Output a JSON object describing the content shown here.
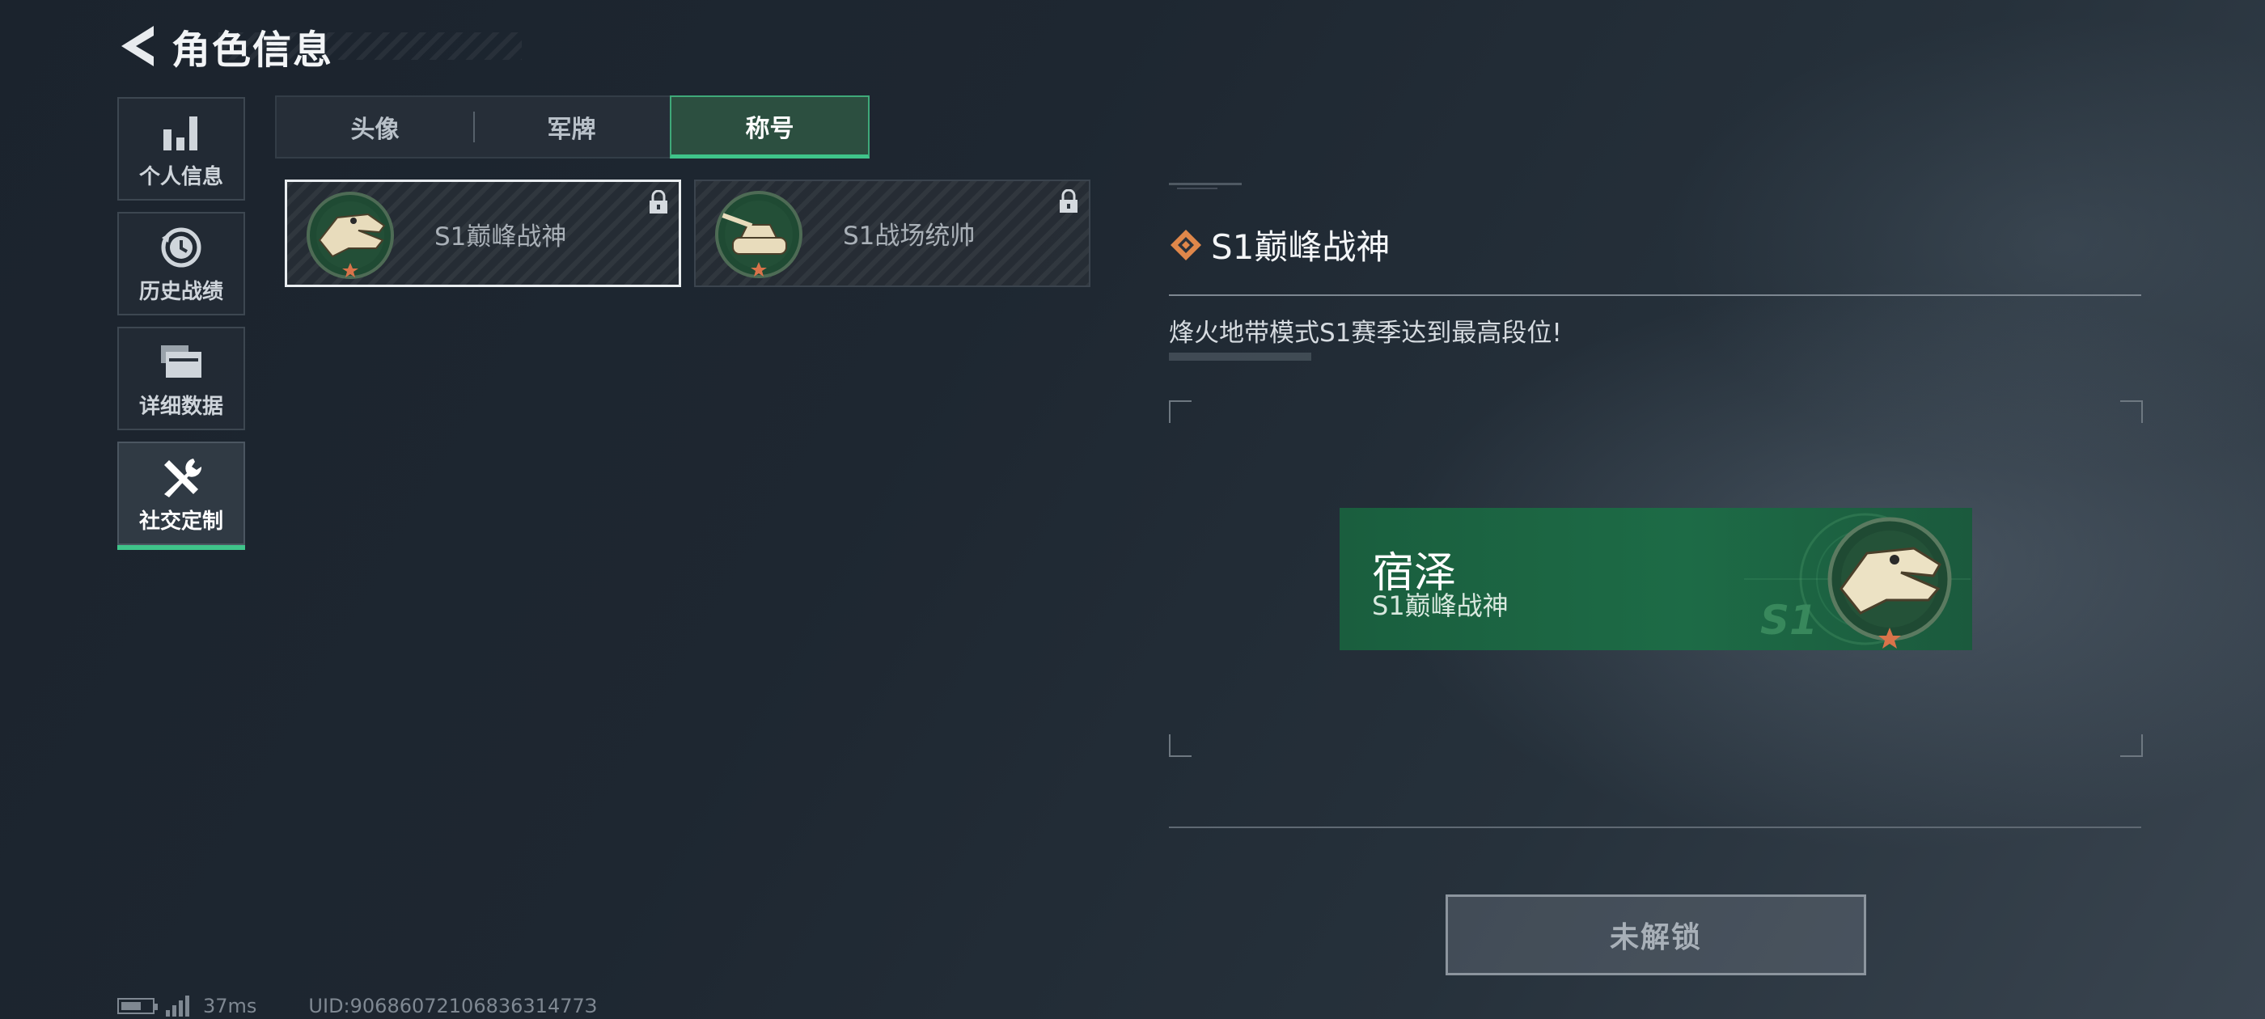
{
  "header": {
    "title": "角色信息"
  },
  "sidebar": {
    "items": [
      {
        "label": "个人信息",
        "icon": "bar-chart-icon",
        "active": false
      },
      {
        "label": "历史战绩",
        "icon": "history-icon",
        "active": false
      },
      {
        "label": "详细数据",
        "icon": "folder-icon",
        "active": false
      },
      {
        "label": "社交定制",
        "icon": "tools-icon",
        "active": true
      }
    ]
  },
  "tabs": [
    {
      "label": "头像",
      "active": false
    },
    {
      "label": "军牌",
      "active": false
    },
    {
      "label": "称号",
      "active": true
    }
  ],
  "title_cards": [
    {
      "label": "S1巅峰战神",
      "emblem": "crocodile-emblem-icon",
      "locked": true,
      "selected": true
    },
    {
      "label": "S1战场统帅",
      "emblem": "tank-emblem-icon",
      "locked": true,
      "selected": false
    }
  ],
  "detail": {
    "title": "S1巅峰战神",
    "description": "烽火地带模式S1赛季达到最高段位!"
  },
  "preview": {
    "player_name": "宿泽",
    "title": "S1巅峰战神",
    "season_mark": "S1"
  },
  "action": {
    "unlock_label": "未解锁"
  },
  "status_bar": {
    "ping": "37ms",
    "uid": "UID:9068607210683631477З"
  },
  "colors": {
    "accent": "#3fc48a",
    "title_icon": "#e0874a",
    "preview_bg": "#1d6b46"
  }
}
